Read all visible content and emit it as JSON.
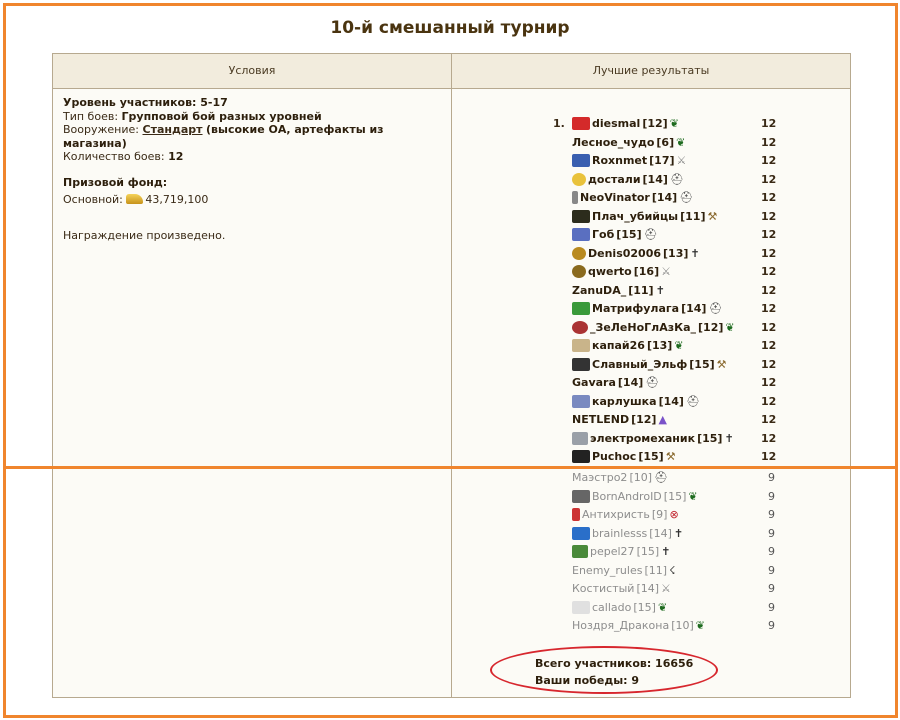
{
  "page_title": "10-й смешанный турнир",
  "headers": {
    "conditions": "Условия",
    "best_results": "Лучшие результаты"
  },
  "conditions": {
    "level": "Уровень участников: 5-17",
    "fight_type_label": "Тип боев:",
    "fight_type_value": "Групповой бой разных уровней",
    "weapon_label": "Вооружение:",
    "weapon_link": "Стандарт",
    "weapon_note": "(высокие ОА, артефакты из магазина)",
    "fights_count_label": "Количество боев:",
    "fights_count_value": "12",
    "prize_title": "Призовой фонд:",
    "prize_main_label": "Основной:",
    "prize_main_value": "43,719,100",
    "reward_status": "Награждение произведено."
  },
  "results": [
    {
      "rank": "1.",
      "name": "diesmal",
      "level": "[12]",
      "score": "12",
      "clan": "clan-red",
      "cls": "leaf"
    },
    {
      "rank": "",
      "name": "Лесное_чудо",
      "level": "[6]",
      "score": "12",
      "clan": "",
      "cls": "leaf"
    },
    {
      "rank": "",
      "name": "Roxnmet",
      "level": "[17]",
      "score": "12",
      "clan": "clan-blue",
      "cls": "sword"
    },
    {
      "rank": "",
      "name": "достали",
      "level": "[14]",
      "score": "12",
      "clan": "clan-yellow",
      "cls": "helm"
    },
    {
      "rank": "",
      "name": "NeoVinator",
      "level": "[14]",
      "score": "12",
      "clan": "clan-small",
      "cls": "helm"
    },
    {
      "rank": "",
      "name": "Плач_убийцы",
      "level": "[11]",
      "score": "12",
      "clan": "clan-dark",
      "cls": "hammer"
    },
    {
      "rank": "",
      "name": "Гоб",
      "level": "[15]",
      "score": "12",
      "clan": "clan-blue2",
      "cls": "helm"
    },
    {
      "rank": "",
      "name": "Denis02006",
      "level": "[13]",
      "score": "12",
      "clan": "clan-gold",
      "cls": "cross"
    },
    {
      "rank": "",
      "name": "qwerto",
      "level": "[16]",
      "score": "12",
      "clan": "clan-gold2",
      "cls": "sword"
    },
    {
      "rank": "",
      "name": "ZanuDA_",
      "level": "[11]",
      "score": "12",
      "clan": "",
      "cls": "cross"
    },
    {
      "rank": "",
      "name": "Матрифулага",
      "level": "[14]",
      "score": "12",
      "clan": "clan-green",
      "cls": "helm"
    },
    {
      "rank": "",
      "name": "_ЗеЛеНоГлАзКа_",
      "level": "[12]",
      "score": "12",
      "clan": "clan-scorp",
      "cls": "leaf"
    },
    {
      "rank": "",
      "name": "капай26",
      "level": "[13]",
      "score": "12",
      "clan": "clan-wings",
      "cls": "leaf"
    },
    {
      "rank": "",
      "name": "Славный_Эльф",
      "level": "[15]",
      "score": "12",
      "clan": "clan-dark2",
      "cls": "hammer"
    },
    {
      "rank": "",
      "name": "Gavara",
      "level": "[14]",
      "score": "12",
      "clan": "",
      "cls": "helm"
    },
    {
      "rank": "",
      "name": "карлушка",
      "level": "[14]",
      "score": "12",
      "clan": "clan-shield",
      "cls": "helm"
    },
    {
      "rank": "",
      "name": "NETLEND",
      "level": "[12]",
      "score": "12",
      "clan": "",
      "cls": "wizard"
    },
    {
      "rank": "",
      "name": "электромеханик",
      "level": "[15]",
      "score": "12",
      "clan": "clan-gun",
      "cls": "cross"
    },
    {
      "rank": "",
      "name": "Puchoc",
      "level": "[15]",
      "score": "12",
      "clan": "clan-dark3",
      "cls": "hammer"
    }
  ],
  "results_faded": [
    {
      "name": "Маэстро2",
      "level": "[10]",
      "score": "9",
      "clan": "",
      "cls": "helm"
    },
    {
      "name": "BornAndroID",
      "level": "[15]",
      "score": "9",
      "clan": "clan-gray",
      "cls": "leaf"
    },
    {
      "name": "Антихристь",
      "level": "[9]",
      "score": "9",
      "clan": "clan-hourglass",
      "cls": "bad"
    },
    {
      "name": "brainlesss",
      "level": "[14]",
      "score": "9",
      "clan": "clan-globe",
      "cls": "cross"
    },
    {
      "name": "pepel27",
      "level": "[15]",
      "score": "9",
      "clan": "clan-green2",
      "cls": "cross"
    },
    {
      "name": "Enemy_rules",
      "level": "[11]",
      "score": "9",
      "clan": "",
      "cls": "claw"
    },
    {
      "name": "Костистый",
      "level": "[14]",
      "score": "9",
      "clan": "",
      "cls": "sword"
    },
    {
      "name": "callado",
      "level": "[15]",
      "score": "9",
      "clan": "clan-bg",
      "cls": "leaf"
    },
    {
      "name": "Ноздря_Дракона",
      "level": "[10]",
      "score": "9",
      "clan": "",
      "cls": "leaf"
    }
  ],
  "summary": {
    "total_participants": "Всего участников: 16656",
    "your_wins": "Ваши победы: 9"
  },
  "colors": {
    "highlight_frame": "#f0852d",
    "annotation_circle": "#d7272e",
    "header_bg": "#f2ecdd"
  },
  "class_icons": {
    "leaf": "leaf-icon",
    "helm": "helmet-icon",
    "cross": "cross-icon",
    "sword": "sword-icon",
    "hammer": "hammer-icon",
    "wizard": "wizard-hat-icon",
    "claw": "claw-icon",
    "bad": "forbidden-icon"
  }
}
